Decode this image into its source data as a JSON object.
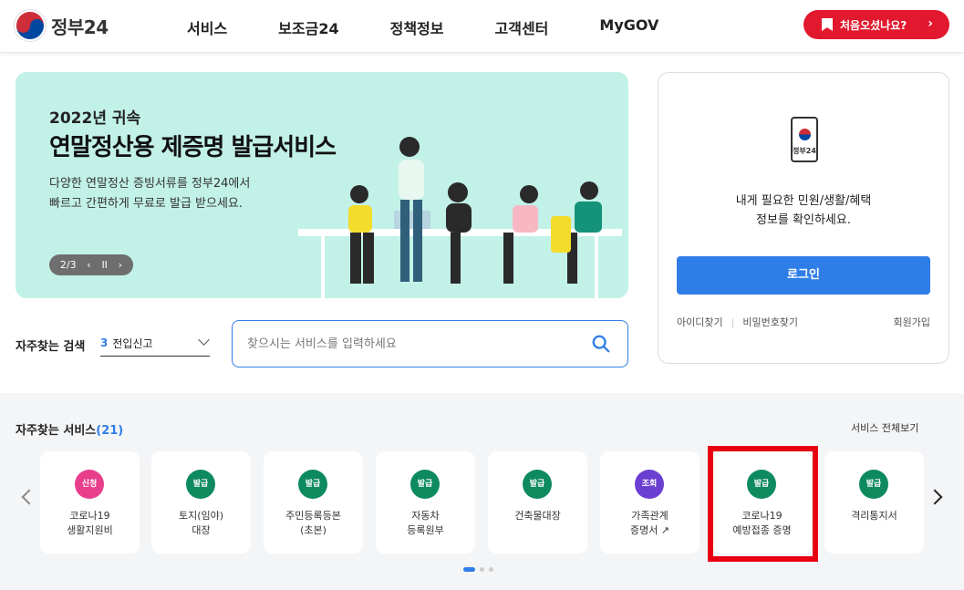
{
  "header": {
    "logo": "정부24",
    "nav": [
      "서비스",
      "보조금24",
      "정책정보",
      "고객센터",
      "MyGOV"
    ],
    "first_visit": "처음오셨나요?"
  },
  "banner": {
    "subtitle": "2022년 귀속",
    "title": "연말정산용 제증명 발급서비스",
    "desc_line1": "다양한 연말정산 증빙서류를 정부24에서",
    "desc_line2": "빠르고 간편하게 무료로 발급 받으세요.",
    "page": "2/3",
    "prev": "‹",
    "pause": "II",
    "next": "›"
  },
  "login": {
    "phone_label": "정부24",
    "msg_line1": "내게 필요한 민원/생활/혜택",
    "msg_line2": "정보를 확인하세요.",
    "button": "로그인",
    "find_id": "아이디찾기",
    "find_pw": "비밀번호찾기",
    "join": "회원가입"
  },
  "search": {
    "label": "자주찾는 검색",
    "keyword_num": "3",
    "keyword": "전입신고",
    "placeholder": "찾으시는 서비스를 입력하세요"
  },
  "services": {
    "title": "자주찾는 서비스",
    "count": "(21)",
    "all": "서비스 전체보기",
    "items": [
      {
        "badge": "신청",
        "label": "코로나19\n생활지원비",
        "color": "#e83e8c"
      },
      {
        "badge": "발급",
        "label": "토지(임야)\n대장",
        "color": "#0e8a5f"
      },
      {
        "badge": "발급",
        "label": "주민등록등본\n(초본)",
        "color": "#0e8a5f"
      },
      {
        "badge": "발급",
        "label": "자동차\n등록원부",
        "color": "#0e8a5f"
      },
      {
        "badge": "발급",
        "label": "건축물대장",
        "color": "#0e8a5f"
      },
      {
        "badge": "조회",
        "label": "가족관계\n증명서 ↗",
        "color": "#6a3fd1"
      },
      {
        "badge": "발급",
        "label": "코로나19\n예방접종 증명",
        "color": "#0e8a5f"
      },
      {
        "badge": "발급",
        "label": "격리통지서",
        "color": "#0e8a5f"
      }
    ]
  },
  "colors": {
    "accent": "#2f7ee8",
    "banner_bg": "#c2f1e7",
    "cta_red": "#e2182e",
    "highlight": "#e60012"
  }
}
